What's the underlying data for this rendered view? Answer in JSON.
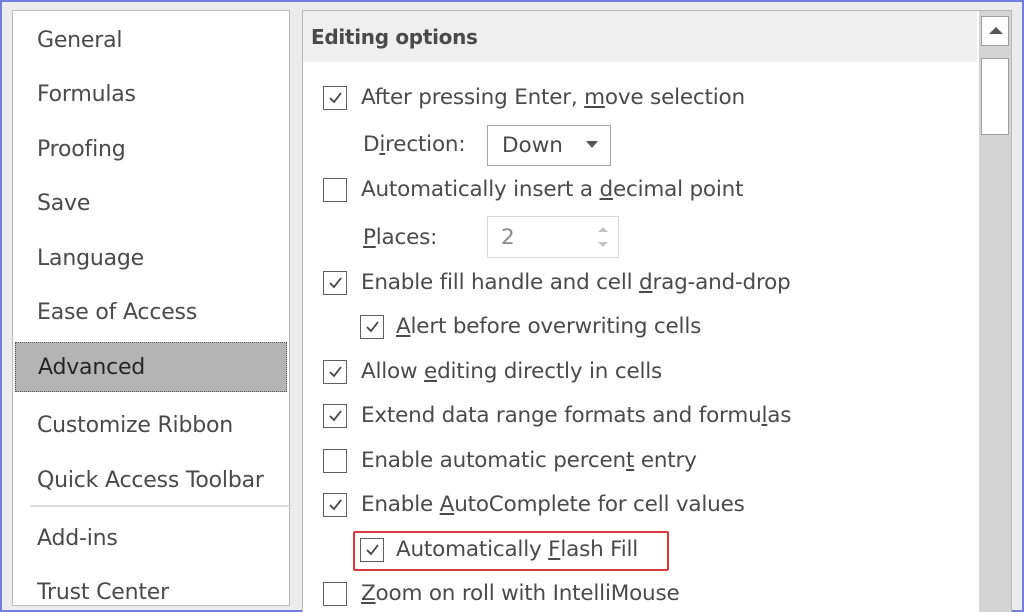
{
  "sidebar": {
    "items": [
      {
        "label": "General",
        "active": false
      },
      {
        "label": "Formulas",
        "active": false
      },
      {
        "label": "Proofing",
        "active": false
      },
      {
        "label": "Save",
        "active": false
      },
      {
        "label": "Language",
        "active": false
      },
      {
        "label": "Ease of Access",
        "active": false
      },
      {
        "label": "Advanced",
        "active": true
      },
      {
        "label": "Customize Ribbon",
        "active": false
      },
      {
        "label": "Quick Access Toolbar",
        "active": false
      },
      {
        "label": "Add-ins",
        "active": false
      },
      {
        "label": "Trust Center",
        "active": false
      }
    ]
  },
  "main": {
    "section_title": "Editing options",
    "options": [
      {
        "pre": "After pressing Enter, ",
        "ul": "m",
        "post": "ove selection",
        "checked": true
      },
      {
        "pre": "Automatically insert a ",
        "ul": "d",
        "post": "ecimal point",
        "checked": false
      },
      {
        "pre": "Enable fill handle and cell ",
        "ul": "d",
        "post": "rag-and-drop",
        "checked": true
      },
      {
        "pre": "",
        "ul": "A",
        "post": "lert before overwriting cells",
        "checked": true
      },
      {
        "pre": "Allow ",
        "ul": "e",
        "post": "diting directly in cells",
        "checked": true
      },
      {
        "pre": "Extend data range formats and formu",
        "ul": "l",
        "post": "as",
        "checked": true
      },
      {
        "pre": "Enable automatic percen",
        "ul": "t",
        "post": " entry",
        "checked": false
      },
      {
        "pre": "Enable ",
        "ul": "A",
        "post": "utoComplete for cell values",
        "checked": true
      },
      {
        "pre": "Automatically ",
        "ul": "F",
        "post": "lash Fill",
        "checked": true
      },
      {
        "pre": "",
        "ul": "Z",
        "post": "oom on roll with IntelliMouse",
        "checked": false
      }
    ],
    "direction": {
      "label_pre": "D",
      "label_ul": "i",
      "label_post": "rection:",
      "value": "Down"
    },
    "places": {
      "label_ul": "P",
      "label_post": "laces:",
      "value": "2"
    },
    "highlight_color": "#d9393f"
  }
}
